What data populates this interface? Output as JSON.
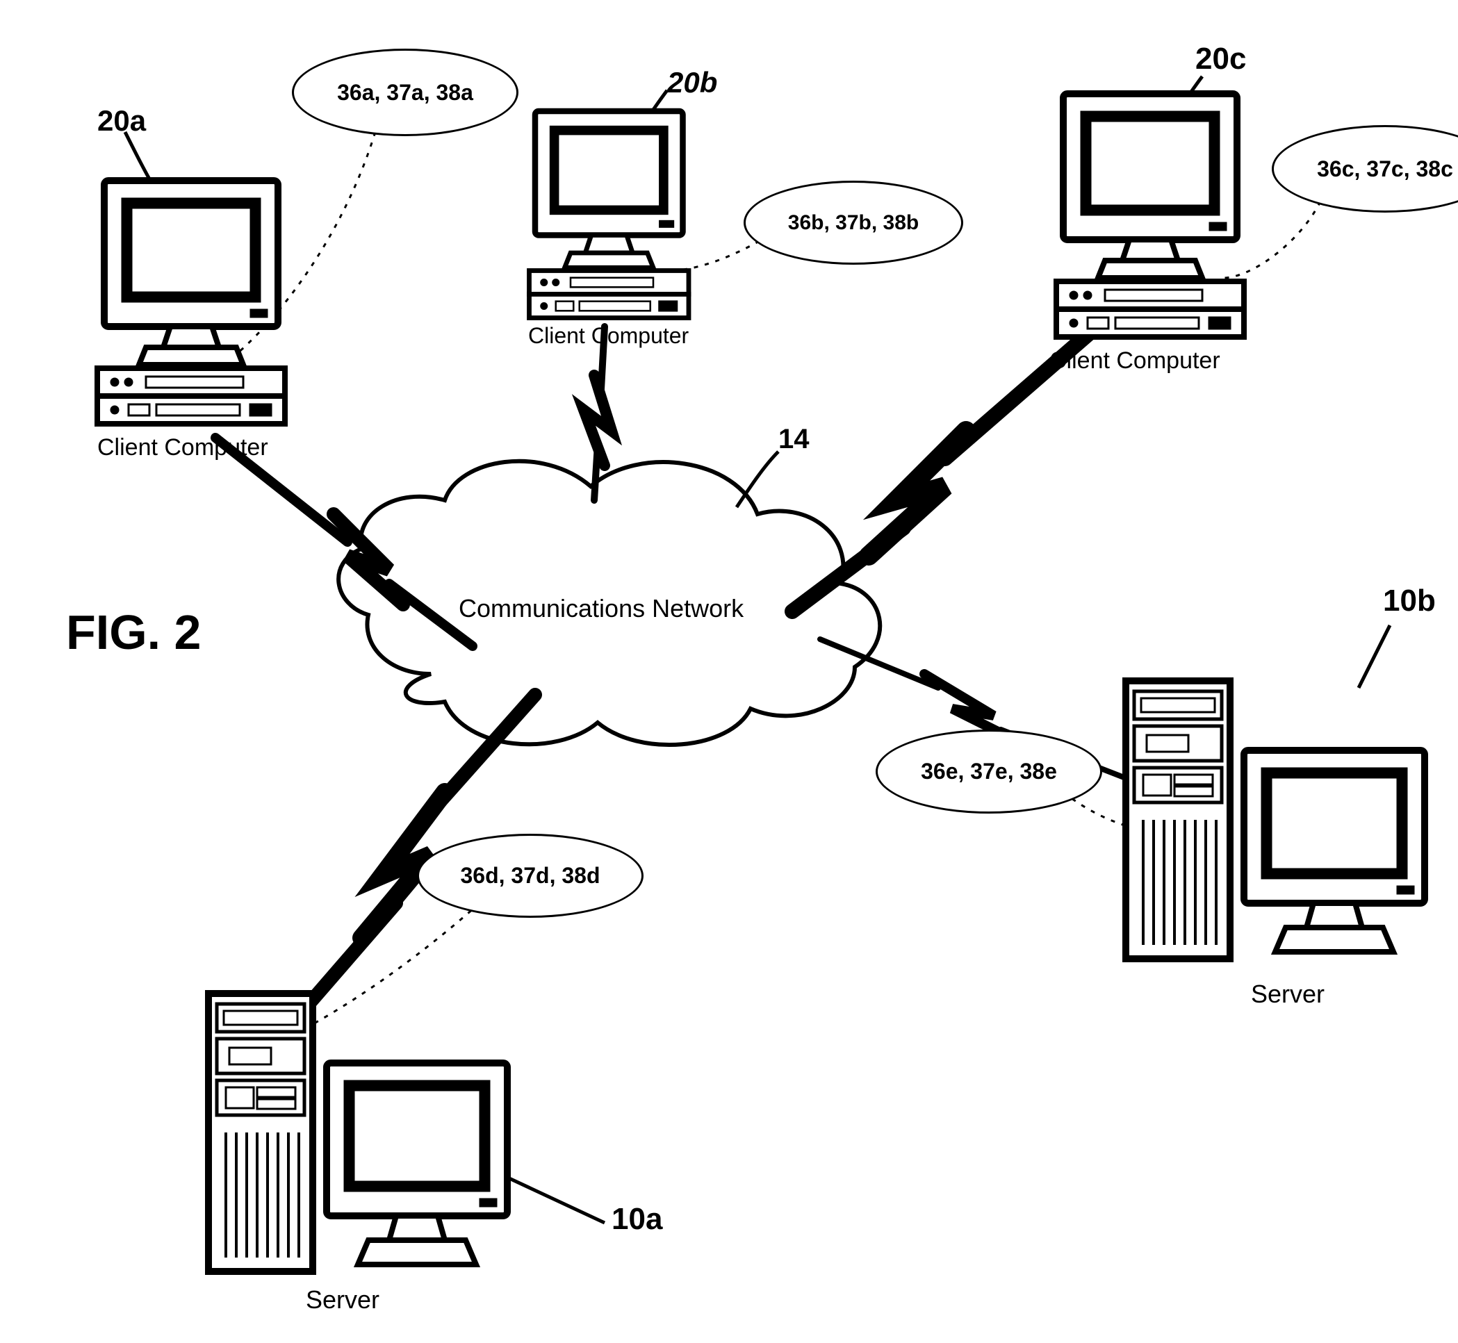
{
  "figure": {
    "title": "FIG. 2"
  },
  "refs": {
    "client_a": "20a",
    "client_b": "20b",
    "client_c": "20c",
    "server_a": "10a",
    "server_b": "10b",
    "cloud": "14"
  },
  "captions": {
    "client": "Client Computer",
    "server": "Server",
    "cloud": "Communications Network"
  },
  "bubbles": {
    "a": "36a, 37a, 38a",
    "b": "36b, 37b, 38b",
    "c": "36c, 37c, 38c",
    "d": "36d, 37d, 38d",
    "e": "36e, 37e, 38e"
  }
}
